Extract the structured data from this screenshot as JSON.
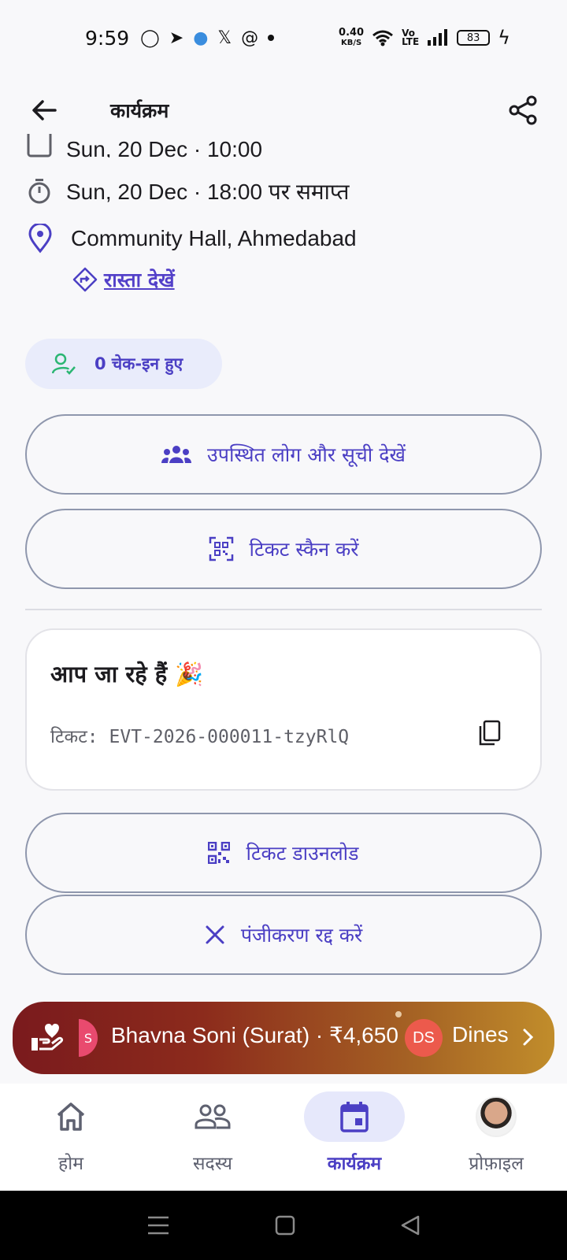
{
  "status_bar": {
    "time": "9:59",
    "net_speed_value": "0.40",
    "net_speed_unit": "KB/S",
    "battery": "83"
  },
  "app_bar": {
    "title": "कार्यक्रम"
  },
  "event": {
    "start_partial": "Sun, 20 Dec · 10:00",
    "end": "Sun, 20 Dec · 18:00 पर समाप्त",
    "location": "Community Hall, Ahmedabad",
    "directions_label": "रास्ता देखें"
  },
  "checkin": {
    "label": "0 चेक-इन हुए"
  },
  "buttons": {
    "attendees": "उपस्थित लोग और सूची देखें",
    "scan": "टिकट स्कैन करें",
    "download": "टिकट डाउनलोड",
    "cancel": "पंजीकरण रद्द करें"
  },
  "ticket_card": {
    "heading": "आप जा रहे हैं 🎉",
    "ticket_label": "टिकट:",
    "ticket_id": "EVT-2026-000011-tzyRlQ"
  },
  "ticker": {
    "partial_initial": "S",
    "entry1": "Bhavna Soni (Surat) · ₹4,650",
    "avatar2_initials": "DS",
    "entry2_partial": "Dinesh"
  },
  "bottom_nav": {
    "home": "होम",
    "members": "सदस्य",
    "events": "कार्यक्रम",
    "profile": "प्रोफ़ाइल"
  },
  "colors": {
    "accent": "#4b3fc4",
    "chip_bg": "#e9ecfb",
    "outline": "#8f97ad",
    "checkin_icon": "#2bb673"
  }
}
